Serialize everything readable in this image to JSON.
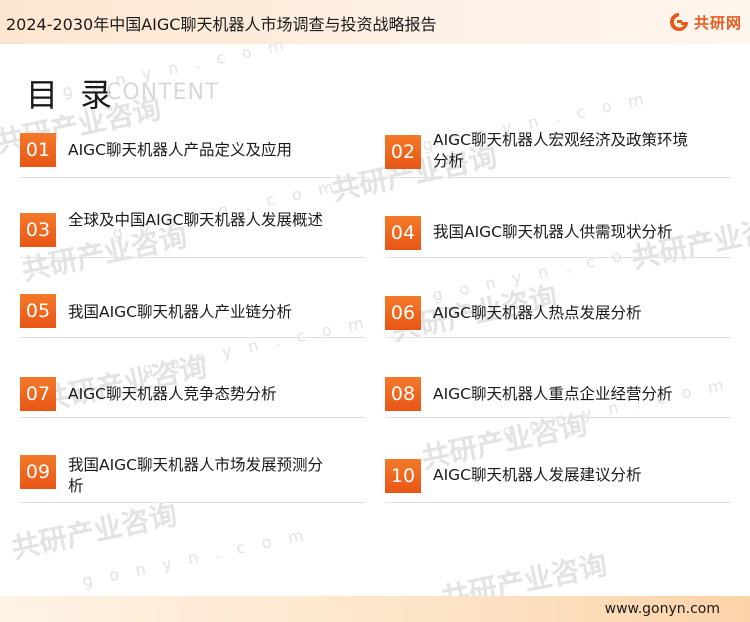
{
  "header": {
    "title": "2024-2030年中国AIGC聊天机器人市场调查与投资战略报告",
    "logo_text": "共研网"
  },
  "toc": {
    "title_cn": "目 录",
    "title_en": "CONTENT",
    "items": [
      {
        "num": "01",
        "label": "AIGC聊天机器人产品定义及应用"
      },
      {
        "num": "02",
        "label": "AIGC聊天机器人宏观经济及政策环境分析"
      },
      {
        "num": "03",
        "label": "全球及中国AIGC聊天机器人发展概述"
      },
      {
        "num": "04",
        "label": "我国AIGC聊天机器人供需现状分析"
      },
      {
        "num": "05",
        "label": "我国AIGC聊天机器人产业链分析"
      },
      {
        "num": "06",
        "label": "AIGC聊天机器人热点发展分析"
      },
      {
        "num": "07",
        "label": "AIGC聊天机器人竞争态势分析"
      },
      {
        "num": "08",
        "label": "AIGC聊天机器人重点企业经营分析"
      },
      {
        "num": "09",
        "label": "我国AIGC聊天机器人市场发展预测分析"
      },
      {
        "num": "10",
        "label": "AIGC聊天机器人发展建议分析"
      }
    ]
  },
  "watermark": {
    "text": "共研产业咨询",
    "domain": "g o n y n . c o m"
  },
  "footer": {
    "url": "www.gonyn.com"
  },
  "colors": {
    "accent": "#e85616",
    "header_bg": "#fde6cf",
    "footer_bg": "#fbd3a8"
  }
}
